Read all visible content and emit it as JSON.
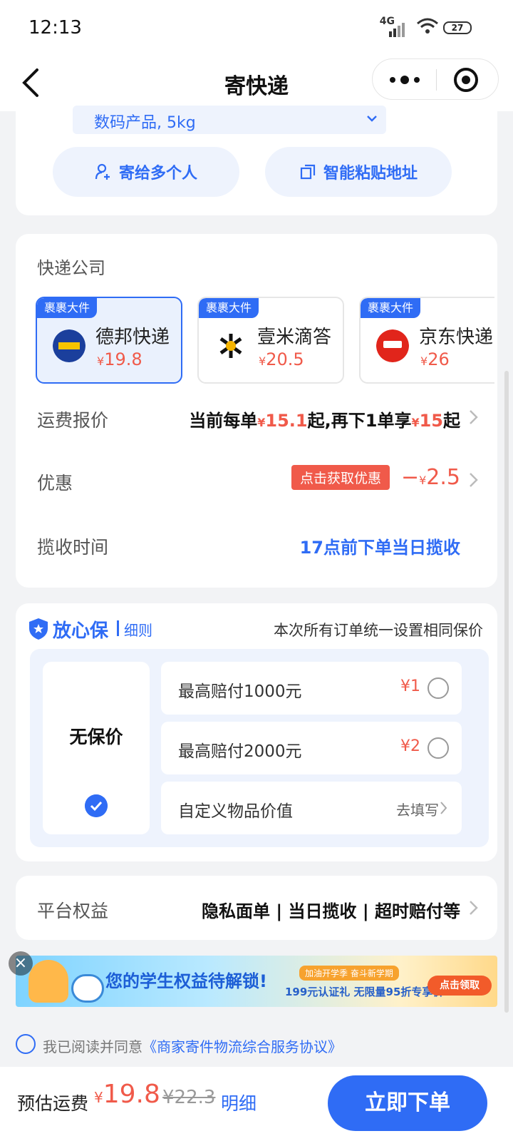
{
  "status": {
    "time": "12:13",
    "network": "4G",
    "battery": "27"
  },
  "nav": {
    "title": "寄快递"
  },
  "package": {
    "goods": "数码产品, 5kg",
    "multi_button": "寄给多个人",
    "paste_button": "智能粘贴地址"
  },
  "carriers": {
    "title": "快递公司",
    "items": [
      {
        "tag": "裹裹大件",
        "name": "德邦快递",
        "currency": "¥",
        "price": "19.8",
        "selected": true
      },
      {
        "tag": "裹裹大件",
        "name": "壹米滴答",
        "currency": "¥",
        "price": "20.5",
        "selected": false
      },
      {
        "tag": "裹裹大件",
        "name": "京东快递",
        "currency": "¥",
        "price": "26",
        "selected": false
      }
    ]
  },
  "rows": {
    "quote_label": "运费报价",
    "quote_a": "当前每单",
    "quote_y1": "¥",
    "quote_p1": "15.1",
    "quote_b": "起,再下1单享",
    "quote_y2": "¥",
    "quote_p2": "15",
    "quote_c": "起",
    "discount_label": "优惠",
    "discount_btn": "点击获取优惠",
    "discount_minus": "−",
    "discount_y": "¥",
    "discount_val": "2.5",
    "pickup_label": "揽收时间",
    "pickup_value": "17点前下单当日揽收"
  },
  "insurance": {
    "brand": "放心保",
    "rules": "细则",
    "note": "本次所有订单统一设置相同保价",
    "none_label": "无保价",
    "options": [
      {
        "label": "最高赔付1000元",
        "price": "¥1"
      },
      {
        "label": "最高赔付2000元",
        "price": "¥2"
      }
    ],
    "custom_label": "自定义物品价值",
    "custom_action": "去填写"
  },
  "benefits": {
    "label": "平台权益",
    "value": "隐私面单 | 当日揽收 | 超时赔付等"
  },
  "banner": {
    "headline": "您的学生权益待解锁!",
    "tag": "加油开学季 奋斗新学期",
    "sub": "199元认证礼 无限量95折专享价",
    "button": "点击领取"
  },
  "agreement": {
    "prefix": "我已阅读并同意",
    "link": "《商家寄件物流综合服务协议》"
  },
  "footer": {
    "est_label": "预估运费",
    "currency": "¥",
    "price": "19.8",
    "original": "¥22.3",
    "detail": "明细",
    "order_button": "立即下单"
  },
  "colors": {
    "accent": "#2f6cf5",
    "price": "#f05a4a"
  }
}
